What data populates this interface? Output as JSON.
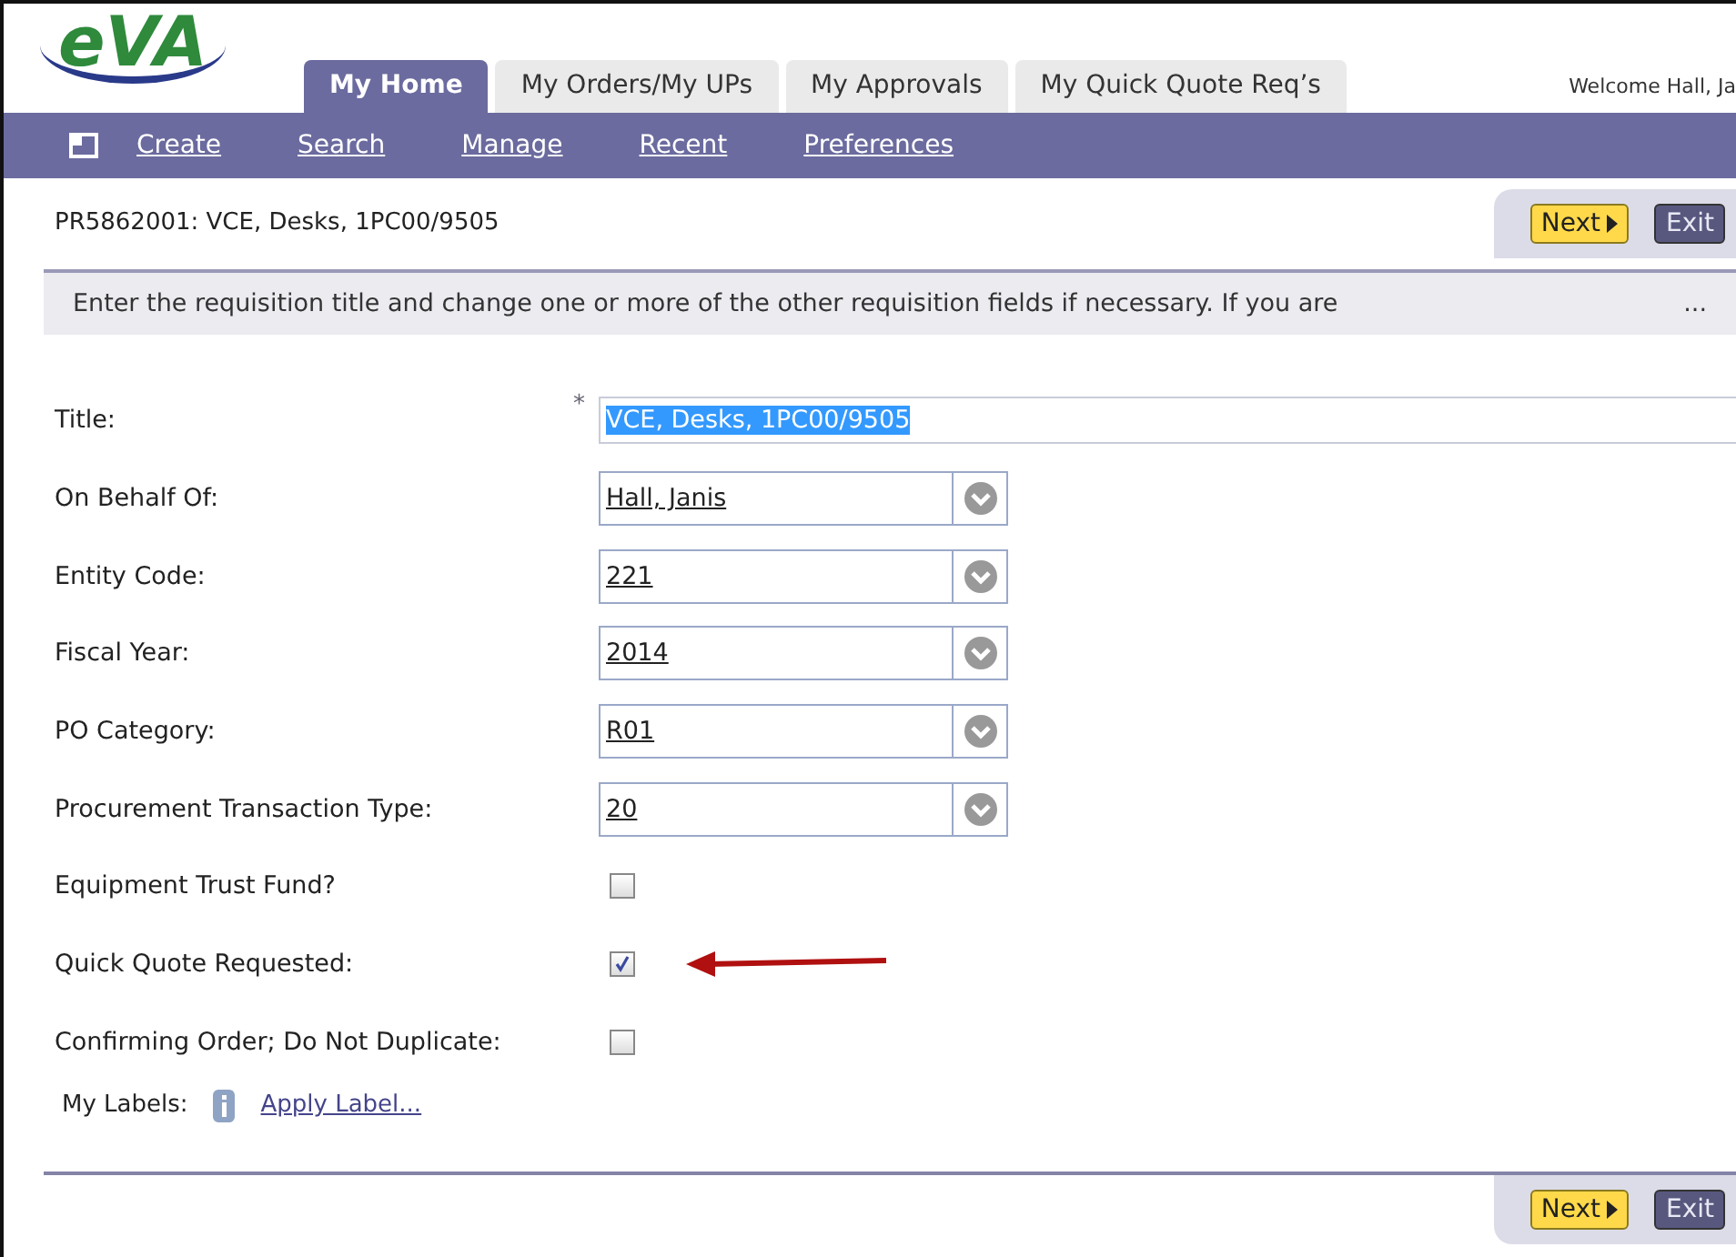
{
  "logo": "eVA",
  "tabs": [
    {
      "label": "My Home",
      "selected": true
    },
    {
      "label": "My Orders/My UPs",
      "selected": false
    },
    {
      "label": "My Approvals",
      "selected": false
    },
    {
      "label": "My Quick Quote Req’s",
      "selected": false
    }
  ],
  "welcome": "Welcome Hall, Ja",
  "menu": [
    "Create",
    "Search",
    "Manage",
    "Recent",
    "Preferences"
  ],
  "header": {
    "title": "PR5862001: VCE, Desks, 1PC00/9505",
    "buttons": [
      {
        "label": "Next",
        "kind": "next"
      },
      {
        "label": "Exit",
        "kind": "exit"
      }
    ]
  },
  "instructions": {
    "text": "Enter the requisition title and change one or more of the other requisition fields if necessary. If you are",
    "more": "..."
  },
  "fields": [
    {
      "label": "Title:",
      "kind": "text",
      "required": "*",
      "value": "VCE, Desks, 1PC00/9505"
    },
    {
      "label": "On Behalf Of:",
      "kind": "select",
      "value": "Hall, Janis"
    },
    {
      "label": "Entity Code:",
      "kind": "select",
      "value": "221"
    },
    {
      "label": "Fiscal Year:",
      "kind": "select",
      "value": "2014"
    },
    {
      "label": "PO Category:",
      "kind": "select",
      "value": "R01"
    },
    {
      "label": "Procurement Transaction Type:",
      "kind": "select",
      "value": "20"
    },
    {
      "label": "Equipment Trust Fund?",
      "kind": "checkbox",
      "checked": false
    },
    {
      "label": "Quick Quote Requested:",
      "kind": "checkbox",
      "checked": true,
      "annotated": true
    },
    {
      "label": "Confirming Order; Do Not Duplicate:",
      "kind": "checkbox",
      "checked": false
    }
  ],
  "labels": {
    "label": "My Labels:",
    "link": "Apply Label..."
  },
  "footer_buttons": [
    {
      "label": "Next",
      "kind": "next"
    },
    {
      "label": "Exit",
      "kind": "exit"
    }
  ]
}
